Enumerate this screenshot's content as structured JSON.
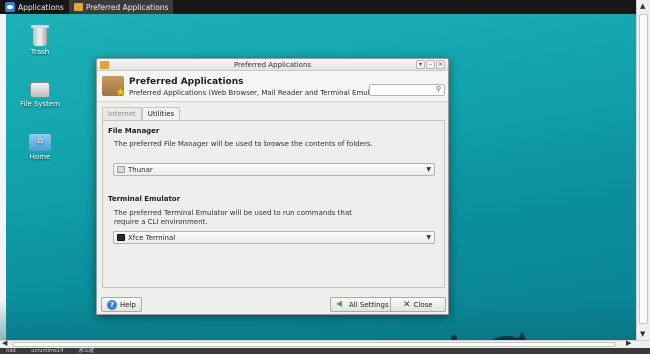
{
  "taskbar": {
    "menu_label": "Applications",
    "window_button_label": "Preferred Applications"
  },
  "desktop": {
    "icons": [
      {
        "label": "Trash",
        "icon": "trash-icon"
      },
      {
        "label": "File System",
        "icon": "drive-icon"
      },
      {
        "label": "Home",
        "icon": "home-folder-icon"
      }
    ]
  },
  "window": {
    "title": "Preferred Applications",
    "header_title": "Preferred Applications",
    "header_subtitle": "Preferred Applications (Web Browser, Mail Reader and Terminal Emulator)",
    "search_placeholder": "",
    "tabs": [
      {
        "label": "Internet",
        "active": false
      },
      {
        "label": "Utilities",
        "active": true
      }
    ],
    "file_manager": {
      "title": "File Manager",
      "description": "The preferred File Manager will be used to browse the contents of folders.",
      "selected": "Thunar"
    },
    "terminal": {
      "title": "Terminal Emulator",
      "description": "The preferred Terminal Emulator will be used to run commands that require a CLI environment.",
      "selected": "Xfce Terminal"
    },
    "buttons": {
      "help": "Help",
      "all_settings": "All Settings",
      "close": "Close"
    }
  },
  "status_strip": [
    "ltdd",
    "ucruntime14",
    "那么键"
  ]
}
